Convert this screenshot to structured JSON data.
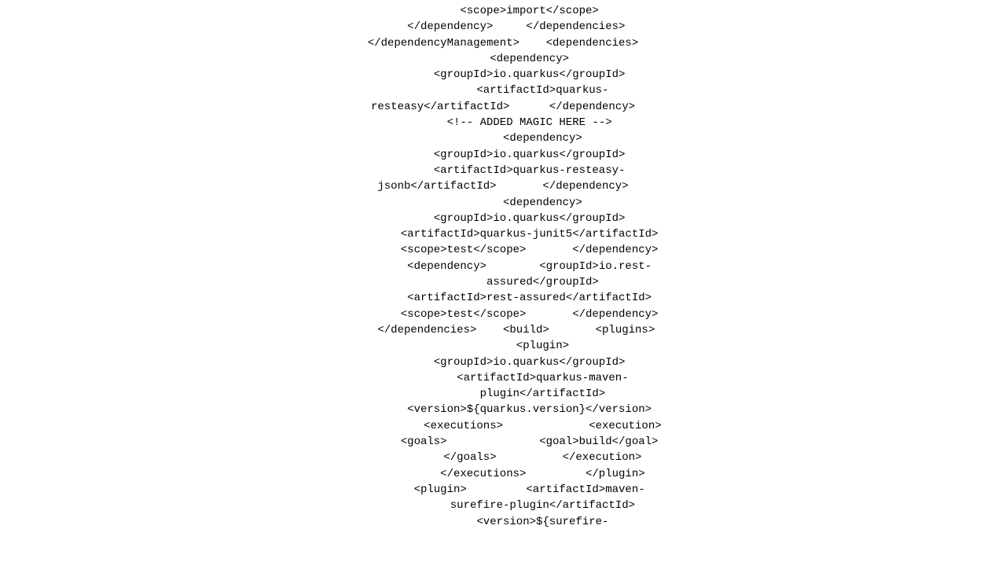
{
  "code": {
    "lines": [
      {
        "id": "line1",
        "text": "        <scope>import</scope>",
        "type": "normal"
      },
      {
        "id": "line2",
        "text": "    </dependency>     </dependencies>",
        "type": "normal"
      },
      {
        "id": "line3",
        "text": "</dependencyManagement>    <dependencies>",
        "type": "normal"
      },
      {
        "id": "line4",
        "text": "        <dependency>",
        "type": "normal"
      },
      {
        "id": "line5",
        "text": "        <groupId>io.quarkus</groupId>",
        "type": "normal"
      },
      {
        "id": "line6",
        "text": "            <artifactId>quarkus-",
        "type": "normal"
      },
      {
        "id": "line7",
        "text": "resteasy</artifactId>      </dependency>",
        "type": "normal"
      },
      {
        "id": "line8",
        "text": "        <!-- ADDED MAGIC HERE -->",
        "type": "comment"
      },
      {
        "id": "line9",
        "text": "            <dependency>",
        "type": "normal"
      },
      {
        "id": "line10",
        "text": "        <groupId>io.quarkus</groupId>",
        "type": "normal"
      },
      {
        "id": "line11",
        "text": "        <artifactId>quarkus-resteasy-",
        "type": "normal"
      },
      {
        "id": "line12",
        "text": "jsonb</artifactId>       </dependency>",
        "type": "normal"
      },
      {
        "id": "line13",
        "text": "            <dependency>",
        "type": "normal"
      },
      {
        "id": "line14",
        "text": "        <groupId>io.quarkus</groupId>",
        "type": "normal"
      },
      {
        "id": "line15",
        "text": "        <artifactId>quarkus-junit5</artifactId>",
        "type": "normal"
      },
      {
        "id": "line16",
        "text": "        <scope>test</scope>       </dependency>",
        "type": "normal"
      },
      {
        "id": "line17",
        "text": "        <dependency>        <groupId>io.rest-",
        "type": "normal"
      },
      {
        "id": "line18",
        "text": "            assured</groupId>",
        "type": "normal"
      },
      {
        "id": "line19",
        "text": "        <artifactId>rest-assured</artifactId>",
        "type": "normal"
      },
      {
        "id": "line20",
        "text": "        <scope>test</scope>       </dependency>",
        "type": "normal"
      },
      {
        "id": "line21",
        "text": "    </dependencies>    <build>       <plugins>",
        "type": "normal"
      },
      {
        "id": "line22",
        "text": "            <plugin>",
        "type": "normal"
      },
      {
        "id": "line23",
        "text": "        <groupId>io.quarkus</groupId>",
        "type": "normal"
      },
      {
        "id": "line24",
        "text": "            <artifactId>quarkus-maven-",
        "type": "normal"
      },
      {
        "id": "line25",
        "text": "            plugin</artifactId>",
        "type": "normal"
      },
      {
        "id": "line26",
        "text": "        <version>${quarkus.version}</version>",
        "type": "normal"
      },
      {
        "id": "line27",
        "text": "            <executions>             <execution>",
        "type": "normal"
      },
      {
        "id": "line28",
        "text": "        <goals>              <goal>build</goal>",
        "type": "normal"
      },
      {
        "id": "line29",
        "text": "            </goals>          </execution>",
        "type": "normal"
      },
      {
        "id": "line30",
        "text": "            </executions>         </plugin>",
        "type": "normal"
      },
      {
        "id": "line31",
        "text": "        <plugin>         <artifactId>maven-",
        "type": "normal"
      },
      {
        "id": "line32",
        "text": "            surefire-plugin</artifactId>",
        "type": "normal"
      },
      {
        "id": "line33",
        "text": "            <version>${surefire-",
        "type": "normal"
      }
    ]
  }
}
